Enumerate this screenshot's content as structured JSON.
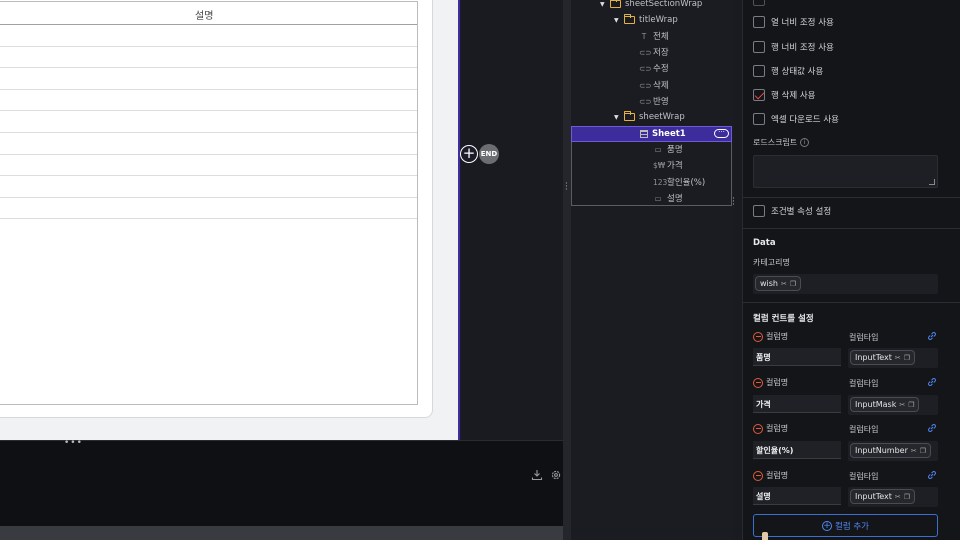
{
  "canvas": {
    "grid_header": "설명",
    "row_count": 9,
    "end_label": "END"
  },
  "tree": {
    "items": [
      {
        "label": "sheetSectionWrap",
        "kind": "folder",
        "caret": "▼"
      },
      {
        "label": "titleWrap",
        "kind": "folder",
        "caret": "▼"
      },
      {
        "label": "전체",
        "kind": "text",
        "icon": "T"
      },
      {
        "label": "저장",
        "kind": "button",
        "icon": "⊂⊃"
      },
      {
        "label": "수정",
        "kind": "button",
        "icon": "⊂⊃"
      },
      {
        "label": "삭제",
        "kind": "button",
        "icon": "⊂⊃"
      },
      {
        "label": "반영",
        "kind": "button",
        "icon": "⊂⊃"
      },
      {
        "label": "sheetWrap",
        "kind": "folder",
        "caret": "▼"
      }
    ],
    "sheet": {
      "label": "Sheet1",
      "more": "···"
    },
    "columns": [
      {
        "label": "품명",
        "icon": "▭"
      },
      {
        "label": "가격",
        "icon": "$₩"
      },
      {
        "label": "할인율(%)",
        "icon": "123"
      },
      {
        "label": "설명",
        "icon": "▭"
      }
    ]
  },
  "props": {
    "checks": [
      {
        "label": "열 너비 조정 사용",
        "checked": false
      },
      {
        "label": "행 너비 조정 사용",
        "checked": false
      },
      {
        "label": "행 상태값 사용",
        "checked": false
      },
      {
        "label": "행 삭제 사용",
        "checked": true
      },
      {
        "label": "엑셀 다운로드 사용",
        "checked": false
      }
    ],
    "load_script_label": "로드스크립트",
    "conditional_label": "조건별 속성 설정",
    "data_section": "Data",
    "category_label": "카테고리명",
    "category_value": "wish",
    "column_control_title": "컬럼 컨트롤 설정",
    "col_name_label": "컬럼명",
    "col_type_label": "컬럼타입",
    "columns": [
      {
        "name": "품명",
        "type": "InputText"
      },
      {
        "name": "가격",
        "type": "InputMask"
      },
      {
        "name": "할인율(%)",
        "type": "InputNumber"
      },
      {
        "name": "설명",
        "type": "InputText"
      }
    ],
    "add_column_label": "컬럼 추가"
  }
}
